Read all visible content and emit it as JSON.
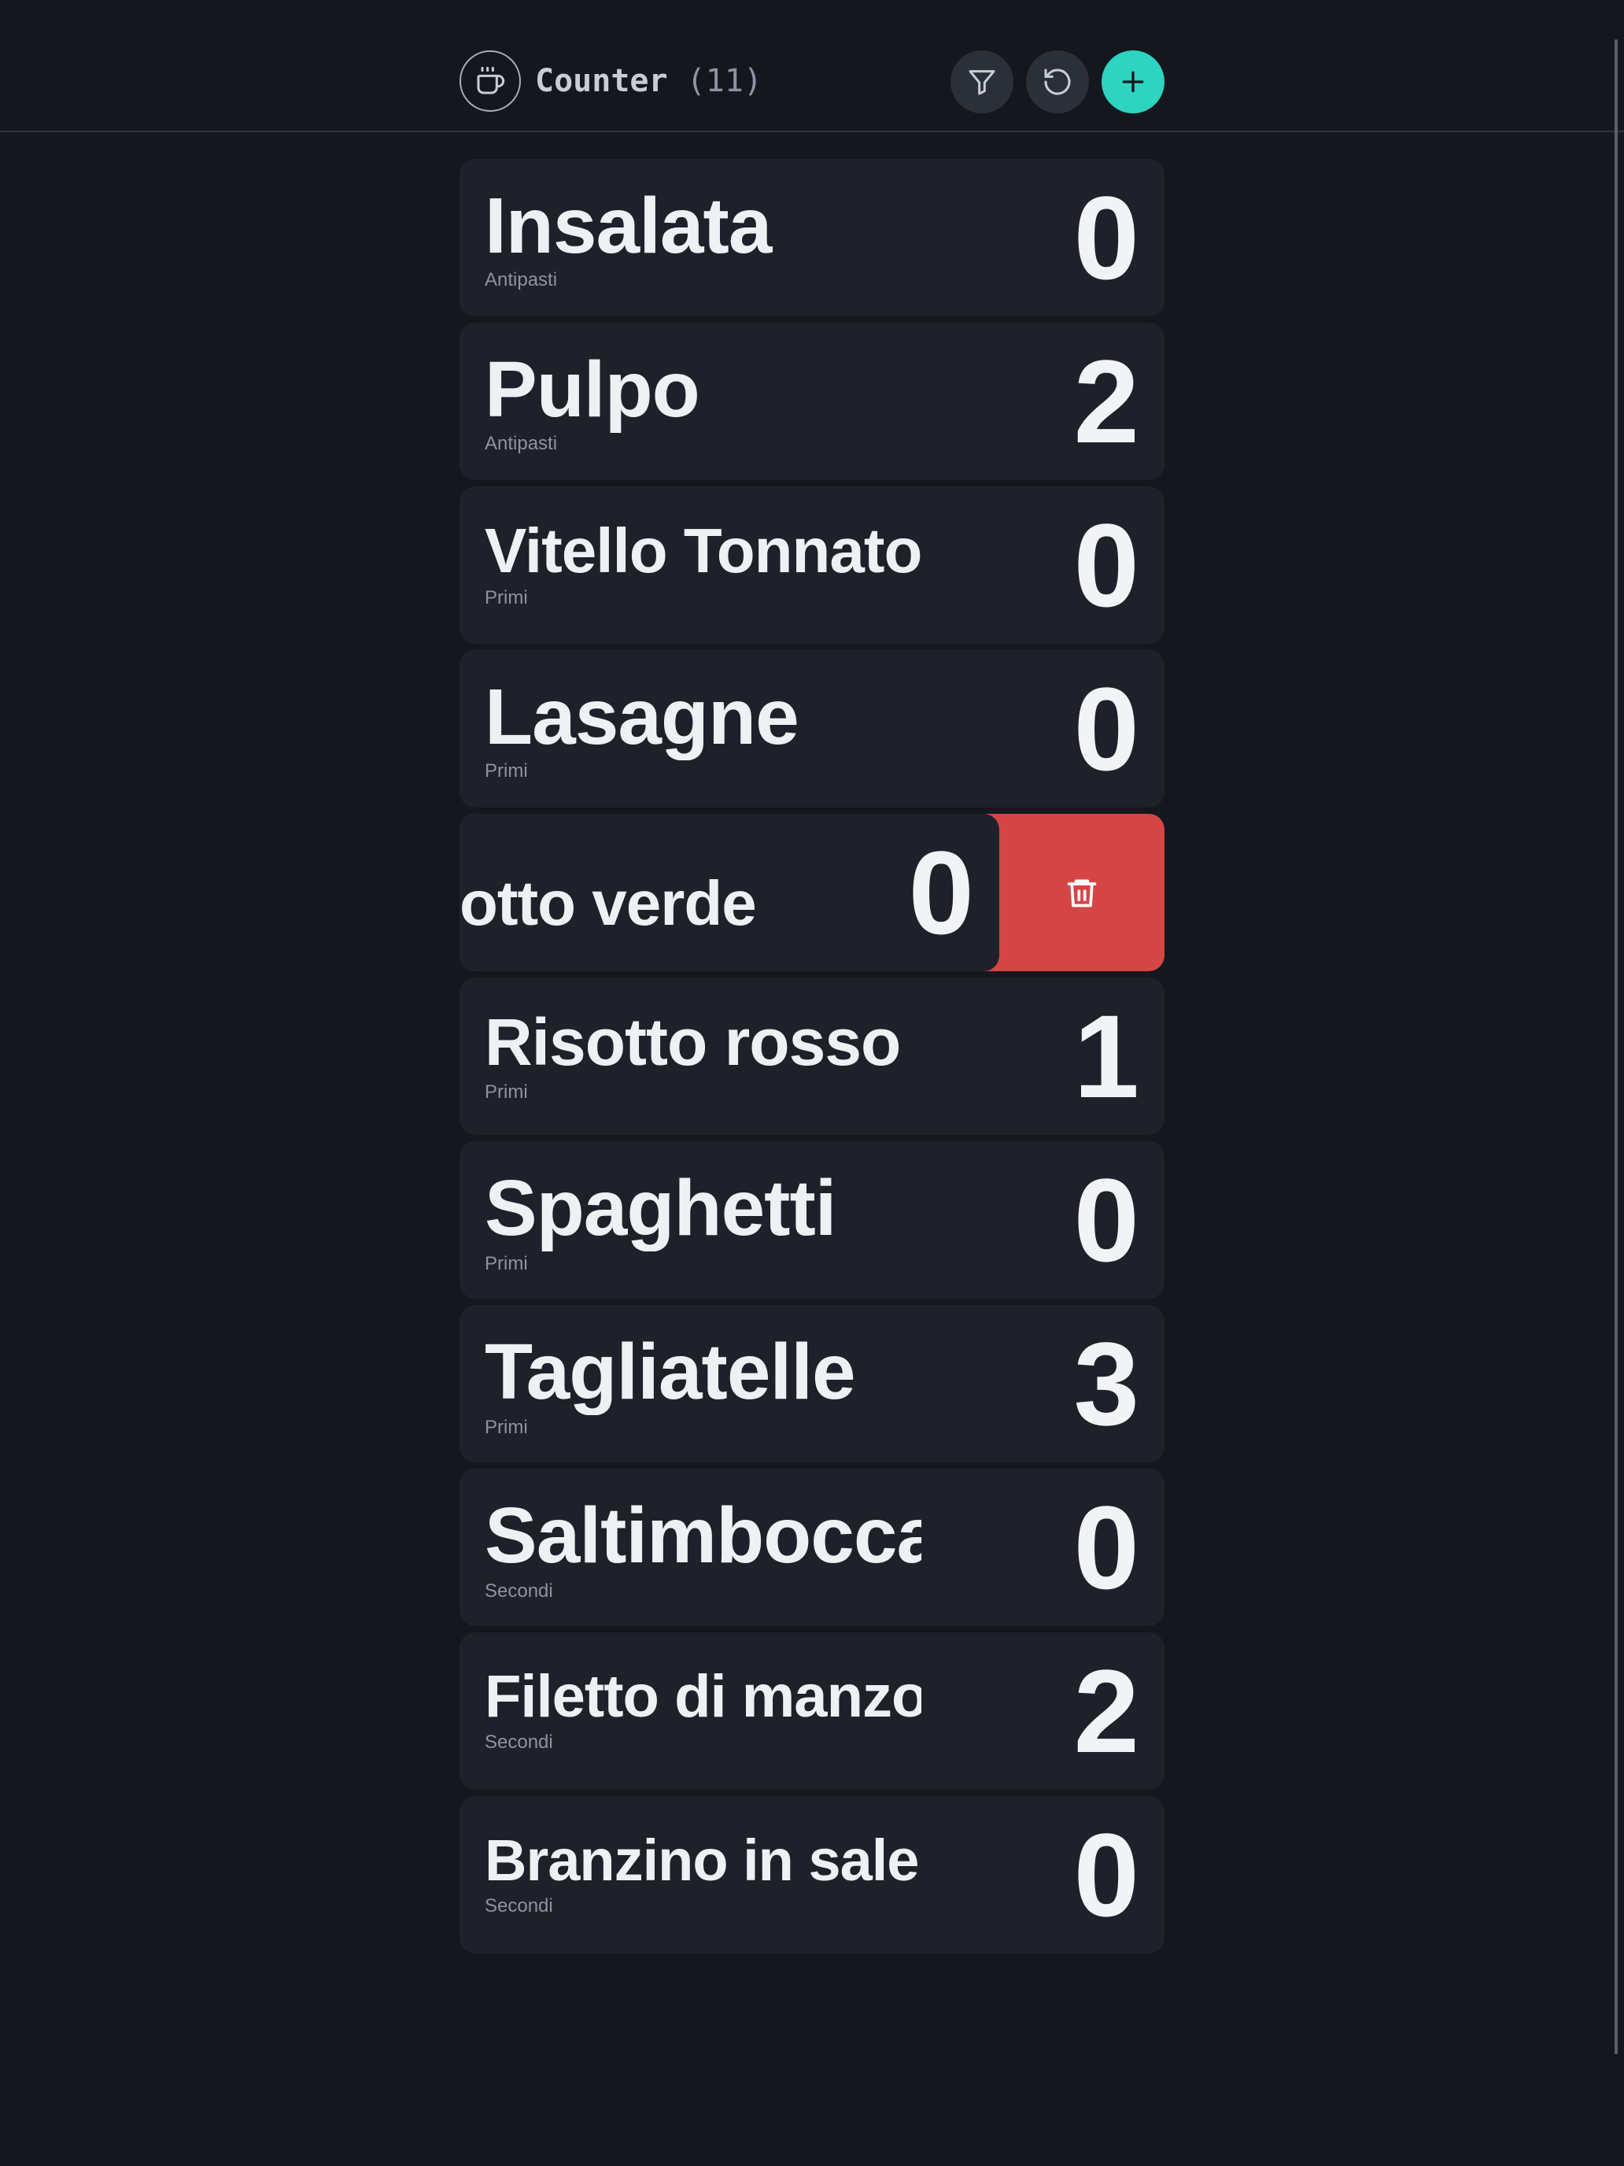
{
  "header": {
    "title": "Counter",
    "count": "(11)",
    "logo_icon": "coffee-cup-icon",
    "filter_icon": "filter-icon",
    "reset_icon": "reset-icon",
    "add_icon": "plus-icon"
  },
  "colors": {
    "background": "#14171e",
    "card": "#1e2129",
    "accent": "#2dd4bf",
    "delete": "#d54546"
  },
  "items": [
    {
      "name": "Insalata",
      "category": "Antipasti",
      "count": "0"
    },
    {
      "name": "Pulpo",
      "category": "Antipasti",
      "count": "2"
    },
    {
      "name": "Vitello Tonnato",
      "category": "Primi",
      "count": "0"
    },
    {
      "name": "Lasagne",
      "category": "Primi",
      "count": "0"
    },
    {
      "name": "otto verde",
      "category": "",
      "count": "0"
    },
    {
      "name": "Risotto rosso",
      "category": "Primi",
      "count": "1"
    },
    {
      "name": "Spaghetti",
      "category": "Primi",
      "count": "0"
    },
    {
      "name": "Tagliatelle",
      "category": "Primi",
      "count": "3"
    },
    {
      "name": "Saltimbocca",
      "category": "Secondi",
      "count": "0"
    },
    {
      "name": "Filetto di manzo",
      "category": "Secondi",
      "count": "2"
    },
    {
      "name": "Branzino in sale",
      "category": "Secondi",
      "count": "0"
    }
  ],
  "swipe_action": {
    "icon": "trash-icon"
  }
}
